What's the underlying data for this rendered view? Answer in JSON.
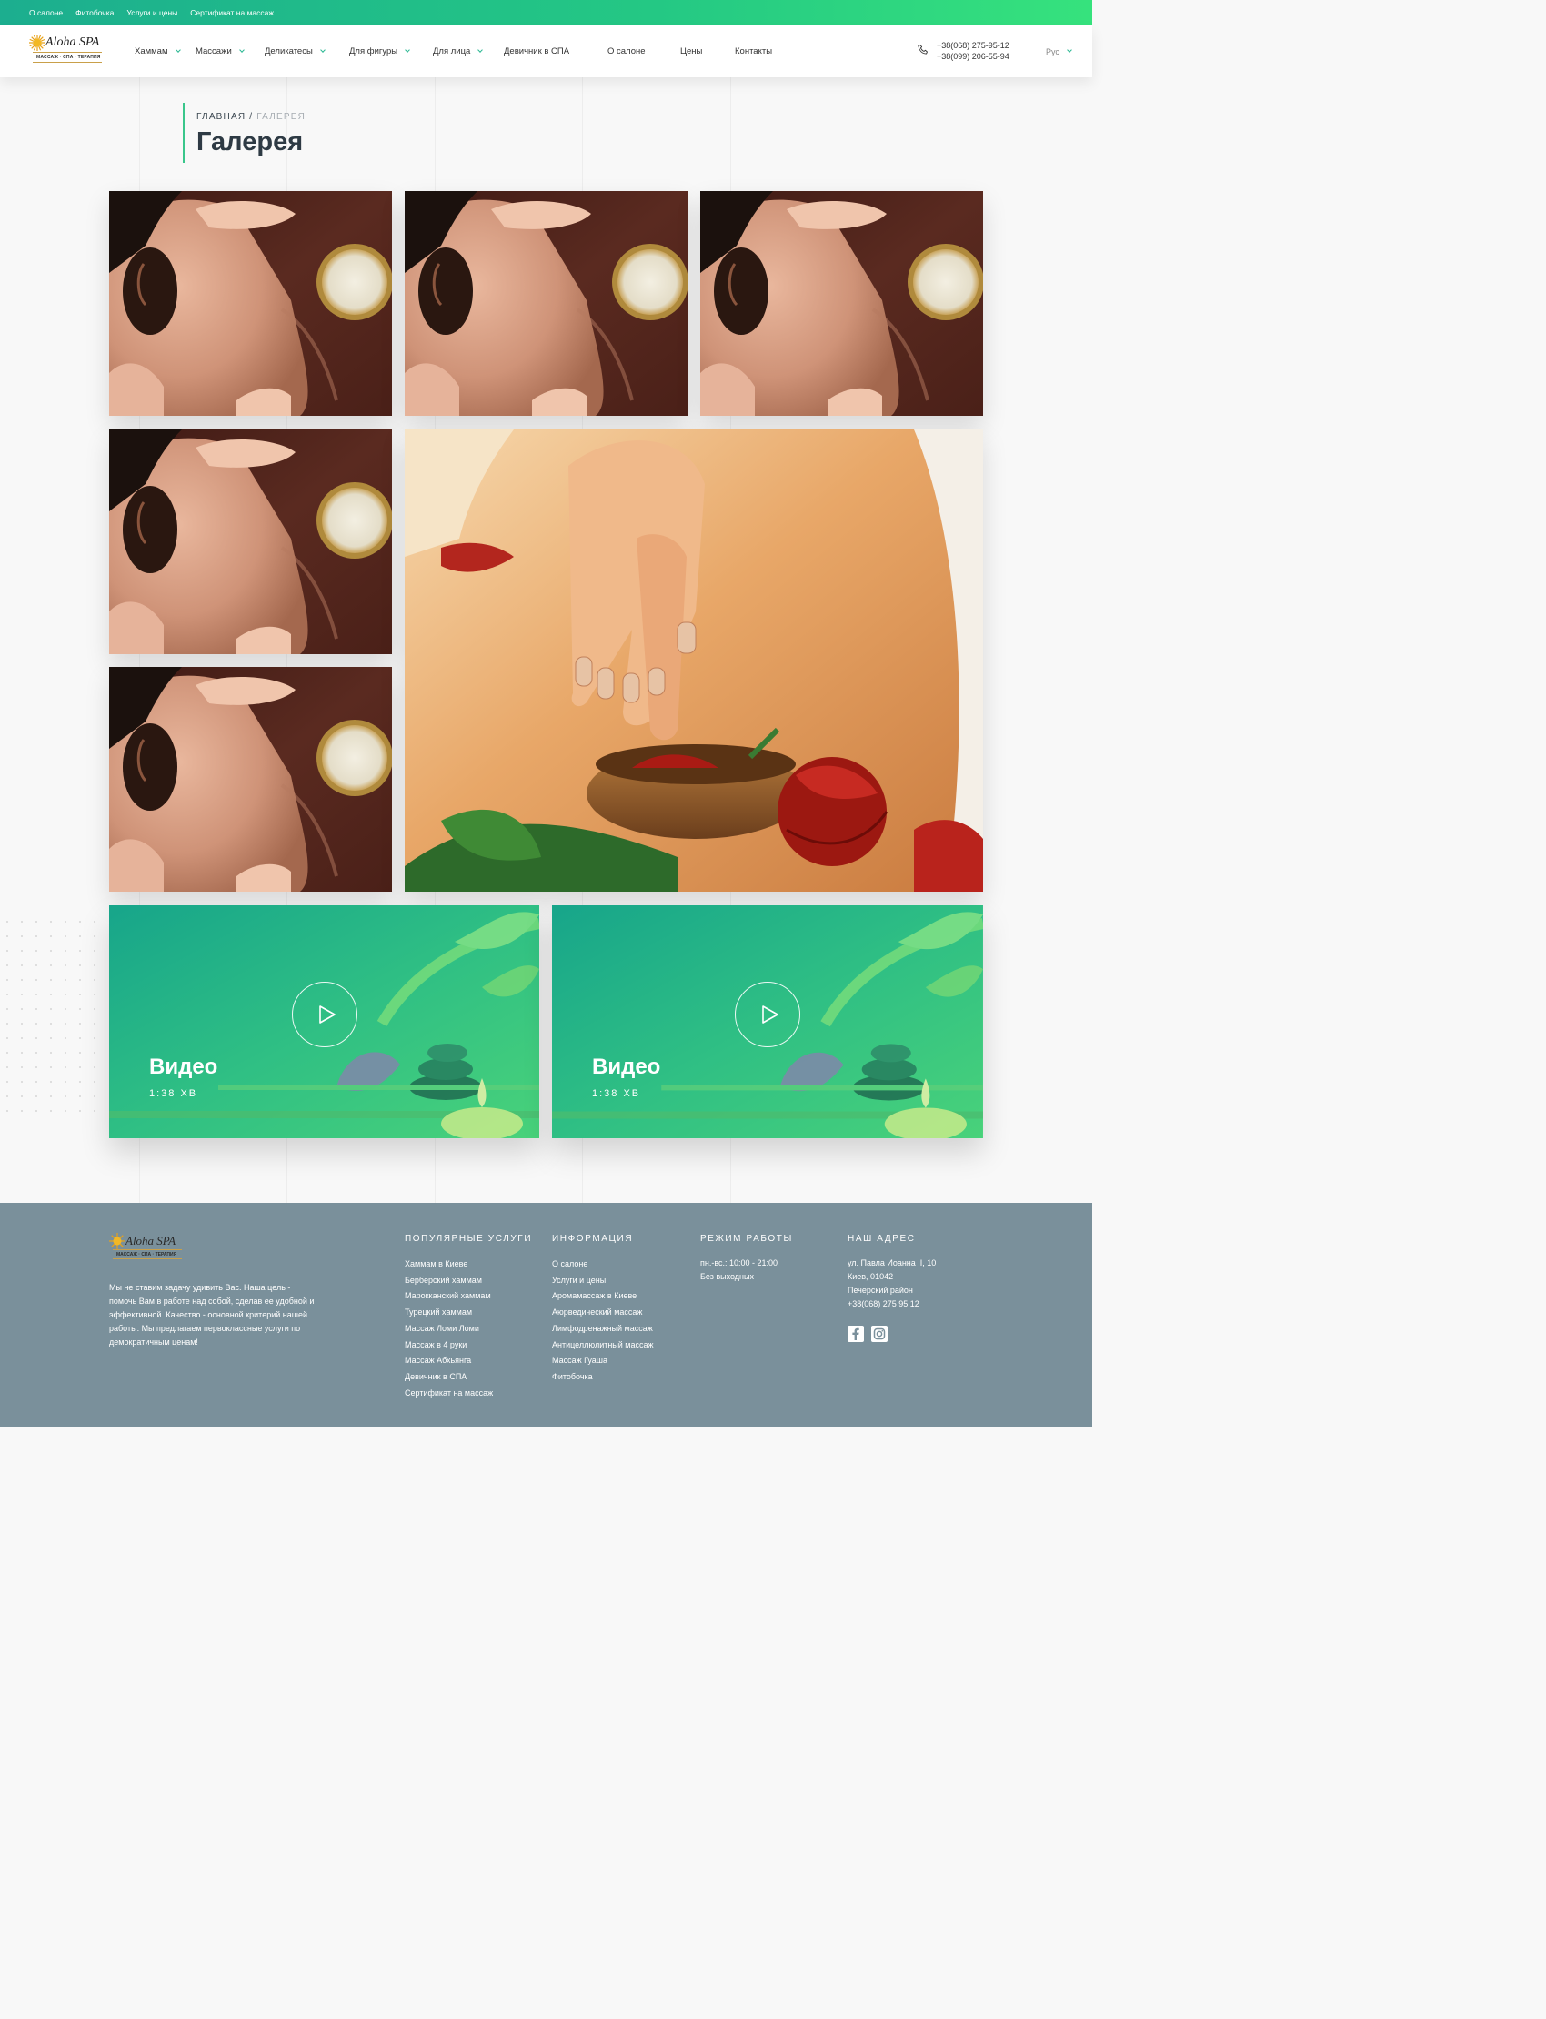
{
  "topbar": {
    "links": [
      "О салоне",
      "Фитобочка",
      "Услуги и цены",
      "Сертификат на массаж"
    ]
  },
  "header": {
    "logo": {
      "brand": "Aloha SPA",
      "tagline": "МАССАЖ · СПА · ТЕРАПИЯ"
    },
    "nav": [
      {
        "label": "Хаммам",
        "dropdown": true
      },
      {
        "label": "Массажи",
        "dropdown": true
      },
      {
        "label": "Деликатесы",
        "dropdown": true
      },
      {
        "label": "Для фигуры",
        "dropdown": true
      },
      {
        "label": "Для лица",
        "dropdown": true
      },
      {
        "label": "Девичник в СПА",
        "dropdown": false
      },
      {
        "label": "О салоне",
        "dropdown": false
      },
      {
        "label": "Цены",
        "dropdown": false
      },
      {
        "label": "Контакты",
        "dropdown": false
      }
    ],
    "phones": [
      "+38(068) 275-95-12",
      "+38(099) 206-55-94"
    ],
    "language": "Рус",
    "icons": {
      "phone": "phone-icon",
      "lang": "chevron-down-icon"
    }
  },
  "breadcrumb": {
    "home": "ГЛАВНАЯ",
    "separator": "/",
    "current": "ГАЛЕРЕЯ"
  },
  "page_title": "Галерея",
  "videos": [
    {
      "title": "Видео",
      "duration": "1:38 ХВ"
    },
    {
      "title": "Видео",
      "duration": "1:38 ХВ"
    }
  ],
  "footer": {
    "logo": {
      "brand": "Aloha SPA",
      "tagline": "МАССАЖ · СПА · ТЕРАПИЯ"
    },
    "about": "Мы не ставим задачу удивить Вас. Наша цель - помочь Вам в работе над собой, сделав ее удобной и эффективной. Качество - основной критерий нашей работы. Мы предлагаем первоклассные услуги по демократичным ценам!",
    "popular": {
      "heading": "ПОПУЛЯРНЫЕ УСЛУГИ",
      "items": [
        "Хаммам в Киеве",
        "Берберский хаммам",
        "Марокканский хаммам",
        "Турецкий хаммам",
        "Массаж Ломи Ломи",
        "Массаж в 4 руки",
        "Массаж Абхьянга",
        "Девичник в СПА",
        "Сертификат на массаж"
      ]
    },
    "info": {
      "heading": "ИНФОРМАЦИЯ",
      "items": [
        "О салоне",
        "Услуги и цены",
        "Аромамассаж в Киеве",
        "Аюрведический массаж",
        "Лимфодренажный массаж",
        "Антицеллюлитный массаж",
        "Массаж Гуаша",
        "Фитобочка"
      ]
    },
    "hours": {
      "heading": "РЕЖИМ РАБОТЫ",
      "lines": [
        "пн.-вс.: 10:00 - 21:00",
        "Без выходных"
      ]
    },
    "address": {
      "heading": "НАШ АДРЕС",
      "lines": [
        "ул. Павла Иоанна II, 10",
        "Киев, 01042",
        "Печерский район",
        "+38(068) 275 95 12"
      ]
    },
    "social": [
      "facebook-icon",
      "instagram-icon"
    ]
  },
  "colors": {
    "accent": "#2bb893",
    "topbar_start": "#1cae8f",
    "topbar_end": "#36e27d",
    "footer_bg": "#7a909b",
    "title": "#2e3a44"
  }
}
